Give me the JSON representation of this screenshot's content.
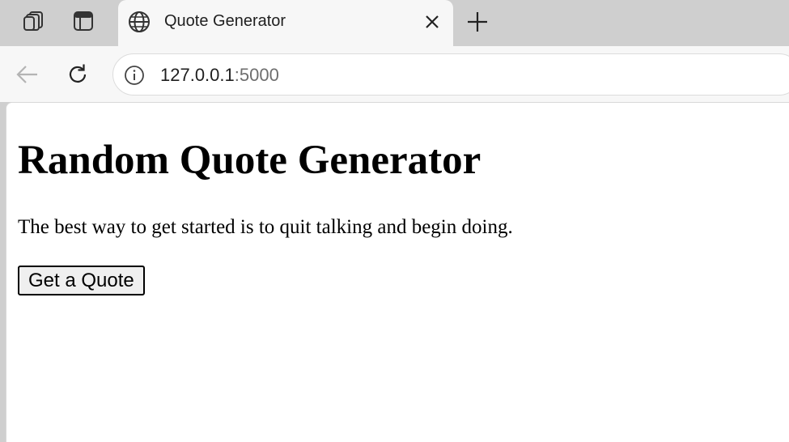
{
  "browser": {
    "tab": {
      "title": "Quote Generator",
      "icon": "globe-icon"
    },
    "tab_strip_icons": [
      "workspaces-icon",
      "vertical-tabs-icon",
      "close-icon",
      "plus-icon"
    ],
    "toolbar": {
      "back_enabled": false,
      "icons": [
        "back-arrow-icon",
        "reload-icon",
        "info-icon"
      ]
    },
    "address_bar": {
      "host": "127.0.0.1",
      "port": ":5000"
    }
  },
  "page": {
    "heading": "Random Quote Generator",
    "quote": "The best way to get started is to quit talking and begin doing.",
    "button_label": "Get a Quote"
  },
  "colors": {
    "tab_strip": "#cfcfcf",
    "toolbar": "#f7f7f7",
    "page_background": "#ffffff",
    "text": "#000000",
    "url_port": "#6e6e6e",
    "button_background": "#efefef"
  }
}
